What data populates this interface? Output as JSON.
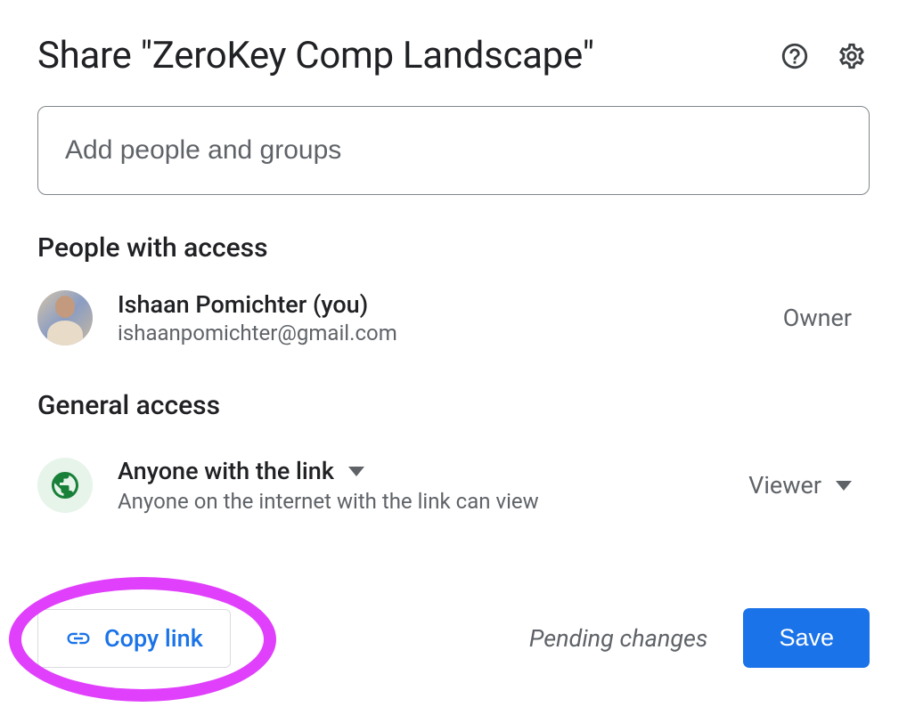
{
  "dialog": {
    "title": "Share \"ZeroKey Comp Landscape\"",
    "input_placeholder": "Add people and groups"
  },
  "sections": {
    "people_heading": "People with access",
    "general_heading": "General access"
  },
  "owner": {
    "name": "Ishaan Pomichter (you)",
    "email": "ishaanpomichter@gmail.com",
    "role": "Owner"
  },
  "general_access": {
    "scope": "Anyone with the link",
    "description": "Anyone on the internet with the link can view",
    "role": "Viewer"
  },
  "footer": {
    "copy_link": "Copy link",
    "pending": "Pending changes",
    "save": "Save"
  }
}
